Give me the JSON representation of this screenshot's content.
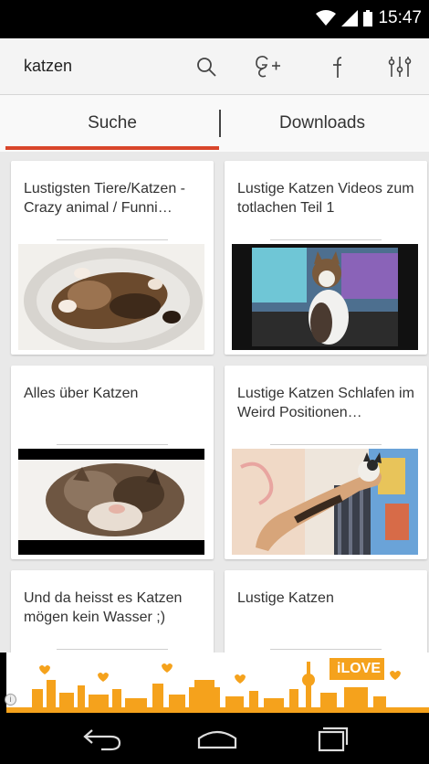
{
  "status_bar": {
    "time": "15:47"
  },
  "toolbar": {
    "query": "katzen",
    "icons": [
      "search-icon",
      "google-plus-icon",
      "facebook-icon",
      "settings-sliders-icon"
    ]
  },
  "tabs": [
    {
      "label": "Suche",
      "active": true
    },
    {
      "label": "Downloads",
      "active": false
    }
  ],
  "colors": {
    "accent": "#d9462b",
    "background": "#e9e9e9",
    "ad_orange": "#f5a21c"
  },
  "videos": [
    {
      "title": "Lustigsten Tiere/Katzen -Crazy animal / Funni…"
    },
    {
      "title": "Lustige Katzen Videos zum totlachen Teil 1"
    },
    {
      "title": "Alles über Katzen"
    },
    {
      "title": "Lustige Katzen Schlafen im Weird Positionen…"
    },
    {
      "title": "Und da heisst es Katzen mögen kein Wasser ;)"
    },
    {
      "title": "Lustige Katzen"
    }
  ],
  "ad": {
    "text": "iLOVE"
  },
  "nav": {
    "icons": [
      "back-icon",
      "home-icon",
      "recent-apps-icon"
    ]
  }
}
